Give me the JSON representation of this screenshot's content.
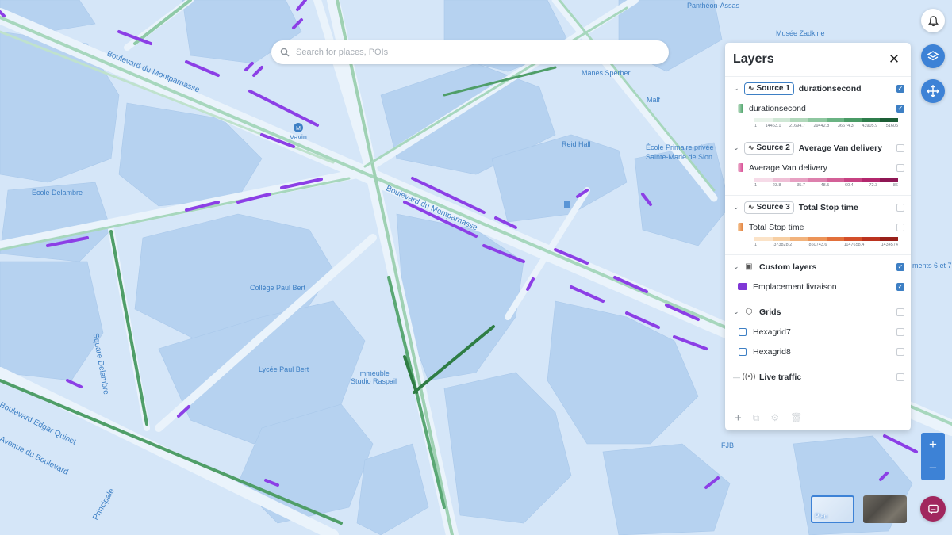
{
  "search": {
    "placeholder": "Search for places, POIs"
  },
  "map": {
    "labels": [
      "Boulevard du Montparnasse",
      "Vavin",
      "École Delambre",
      "Collège Paul Bert",
      "Lycée Paul Bert",
      "Immeuble Studio Raspail",
      "Reid Hall",
      "École Primaire privée",
      "Sainte-Marie de Sion",
      "Manès Sperber",
      "Malf",
      "Musée Zadkine",
      "Panthéon-Assas",
      "Square Delambre",
      "Boulevard Edgar Quinet",
      "Avenue du Boulevard",
      "FJB",
      "Boulevard du Montparnasse",
      "ments 6 et 7",
      "Principale"
    ]
  },
  "layers_panel": {
    "title": "Layers",
    "close": "✕",
    "sources": [
      {
        "badge": "Source 1",
        "name": "durationsecond",
        "checked": true,
        "sub_label": "durationsecond",
        "sub_checked": true,
        "swatch": "#3a9a5a",
        "ramp": [
          "#e8f3ea",
          "#cfe7d5",
          "#b1d8bb",
          "#8ec7a0",
          "#6ab383",
          "#4a9b66",
          "#2f7d4c",
          "#1d5e36"
        ],
        "ticks": [
          "1",
          "14463.1",
          "21694.7",
          "29442.8",
          "36674.3",
          "43905.9",
          "51605"
        ]
      },
      {
        "badge": "Source 2",
        "name": "Average Van delivery",
        "checked": false,
        "sub_label": "Average Van delivery",
        "sub_checked": false,
        "swatch": "#d63a8a",
        "ramp": [
          "#f6dbe8",
          "#efbfd6",
          "#e7a0c2",
          "#dd80ad",
          "#d36097",
          "#c74282",
          "#b3276d",
          "#8e1654"
        ],
        "ticks": [
          "1",
          "23.8",
          "35.7",
          "48.5",
          "60.4",
          "72.3",
          "86"
        ]
      },
      {
        "badge": "Source 3",
        "name": "Total Stop time",
        "checked": false,
        "sub_label": "Total Stop time",
        "sub_checked": false,
        "swatch": "#e0762e",
        "ramp": [
          "#fbe3c8",
          "#f7cfa3",
          "#f2b37c",
          "#ec9458",
          "#e2703b",
          "#d34f2a",
          "#bb331f",
          "#98201a"
        ],
        "ticks": [
          "1",
          "373828.2",
          "860743.6",
          "1147658.4",
          "1434574"
        ]
      }
    ],
    "custom": {
      "title": "Custom layers",
      "checked": true,
      "item": "Emplacement livraison",
      "item_checked": true,
      "color": "#7f37d6"
    },
    "grids": {
      "title": "Grids",
      "checked": false,
      "items": [
        "Hexagrid7",
        "Hexagrid8"
      ]
    },
    "live_traffic": {
      "title": "Live traffic",
      "checked": false
    },
    "footer": [
      "add-icon",
      "copy-icon",
      "settings-icon",
      "trash-icon"
    ]
  },
  "controls": {
    "zoom_in": "+",
    "zoom_out": "−",
    "basemaps": [
      {
        "label": "Plan",
        "selected": true
      },
      {
        "label": "",
        "selected": false
      }
    ],
    "accent": "#3d82d6"
  }
}
